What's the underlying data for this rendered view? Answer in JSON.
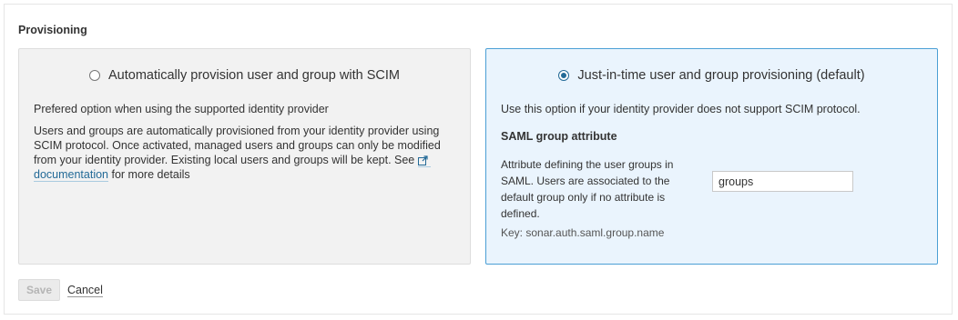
{
  "section": {
    "title": "Provisioning"
  },
  "scim": {
    "label": "Automatically provision user and group with SCIM",
    "preferred": "Prefered option when using the supported identity provider",
    "desc_before_link": "Users and groups are automatically provisioned from your identity provider using SCIM protocol. Once activated, managed users and groups can only be modified from your identity provider. Existing local users and groups will be kept. See ",
    "link_label": "documentation",
    "desc_after_link": " for more details",
    "selected": false
  },
  "jit": {
    "label": "Just-in-time user and group provisioning (default)",
    "selected": true,
    "note": "Use this option if your identity provider does not support SCIM protocol.",
    "attribute_title": "SAML group attribute",
    "attribute_desc": "Attribute defining the user groups in SAML. Users are associated to the default group only if no attribute is defined.",
    "key": "Key: sonar.auth.saml.group.name",
    "attribute_value": "groups"
  },
  "actions": {
    "save_label": "Save",
    "cancel_label": "Cancel"
  },
  "colors": {
    "accent": "#236a97",
    "selected_card_bg": "#eaf4fd",
    "selected_card_border": "#4b9fd5",
    "unselected_card_bg": "#f2f2f2"
  },
  "icons": {
    "radio_unchecked": "radio-unchecked-icon",
    "radio_checked": "radio-checked-icon",
    "external_link": "external-link-icon"
  }
}
